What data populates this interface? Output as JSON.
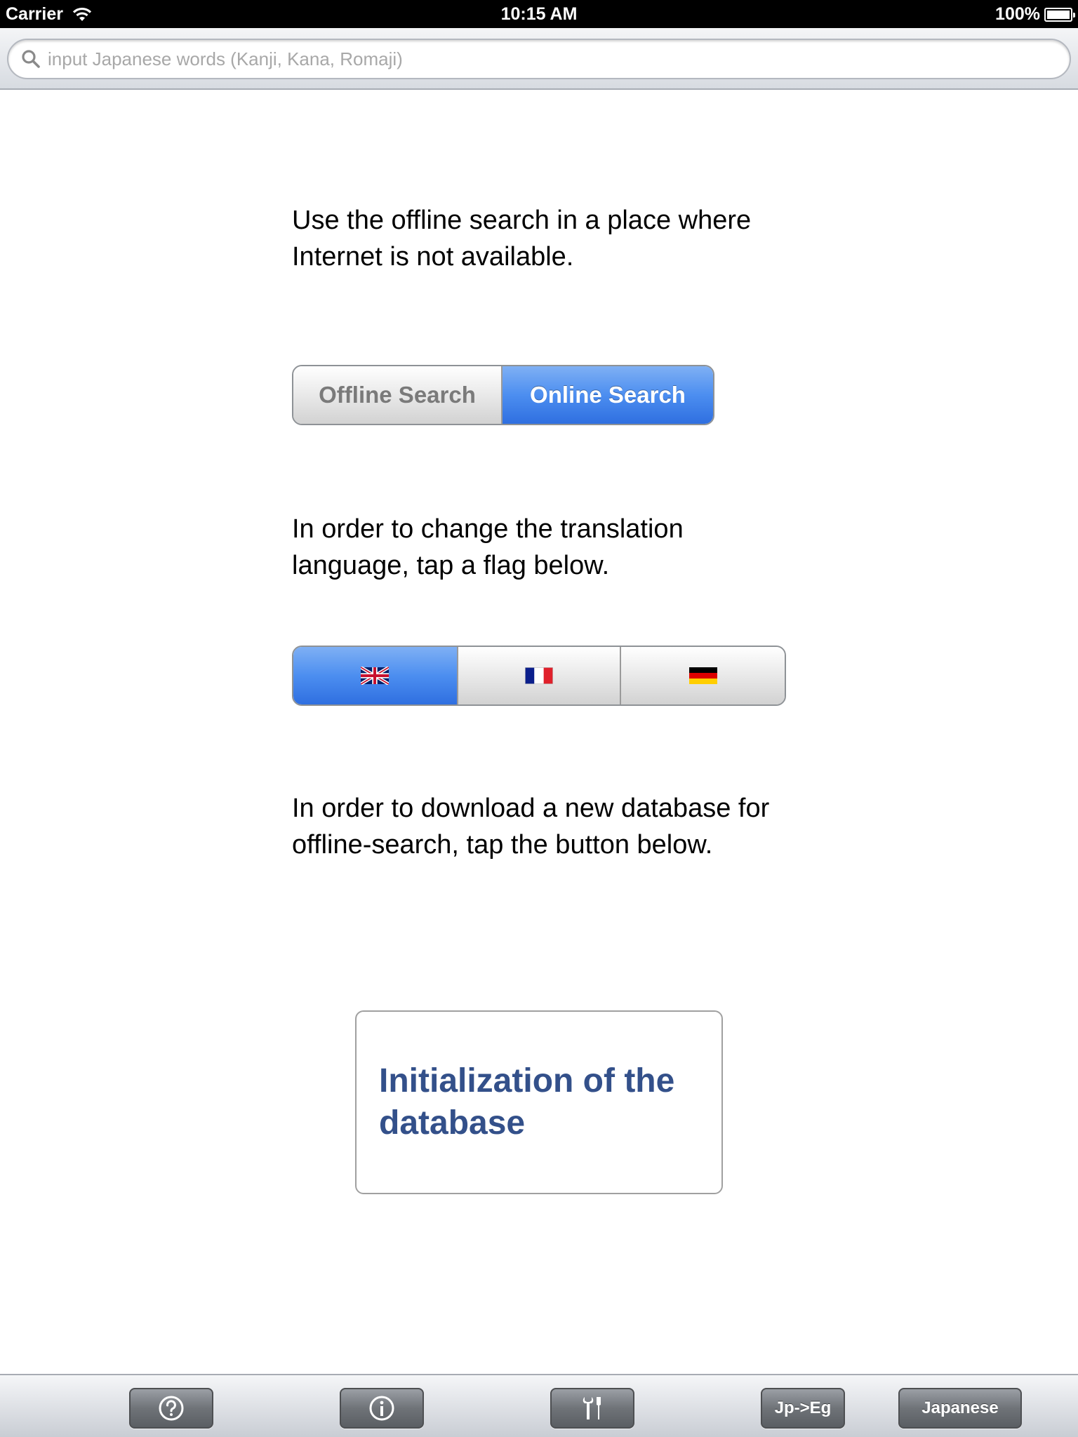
{
  "status_bar": {
    "carrier": "Carrier",
    "time": "10:15 AM",
    "battery": "100%"
  },
  "search": {
    "placeholder": "input Japanese words (Kanji, Kana, Romaji)",
    "value": ""
  },
  "main": {
    "offline_info": "Use the offline search in a place where Internet is not available.",
    "search_mode": {
      "options": [
        "Offline Search",
        "Online Search"
      ],
      "selected": "Online Search"
    },
    "language_info": "In order to change the translation language, tap a flag below.",
    "language_flags": {
      "options": [
        "uk-flag-icon",
        "france-flag-icon",
        "germany-flag-icon"
      ],
      "selected": "uk-flag-icon"
    },
    "download_info": "In order to download a new database for offline-search, tap the button below.",
    "init_button": "Initialization of the database"
  },
  "toolbar": {
    "help_icon": "question-icon",
    "info_icon": "info-icon",
    "settings_icon": "tools-icon",
    "direction_label": "Jp->Eg",
    "language_label": "Japanese"
  },
  "colors": {
    "accent_blue": "#4c8ef0",
    "link_text": "#33508a",
    "toolbar_button": "#6f7378"
  }
}
